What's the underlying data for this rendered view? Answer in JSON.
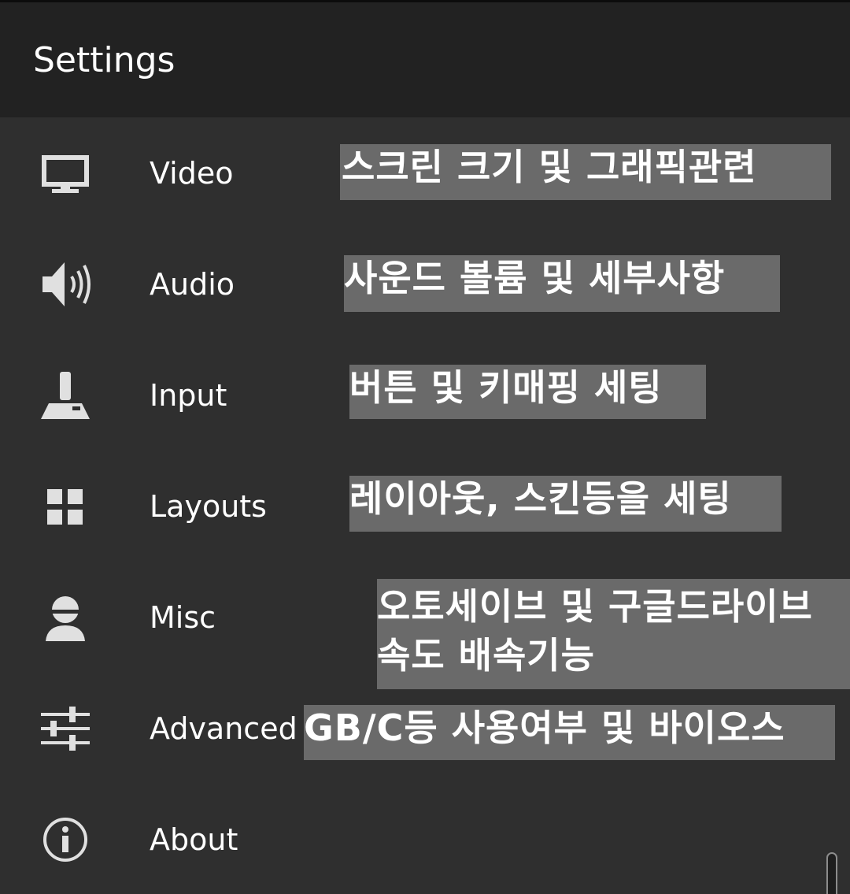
{
  "appbar": {
    "title": "Settings"
  },
  "menu": {
    "video": {
      "label": "Video",
      "icon": "monitor-icon"
    },
    "audio": {
      "label": "Audio",
      "icon": "speaker-icon"
    },
    "input": {
      "label": "Input",
      "icon": "joystick-icon"
    },
    "layouts": {
      "label": "Layouts",
      "icon": "grid-icon"
    },
    "misc": {
      "label": "Misc",
      "icon": "person-icon"
    },
    "advanced": {
      "label": "Advanced",
      "icon": "sliders-icon"
    },
    "about": {
      "label": "About",
      "icon": "info-icon"
    }
  },
  "notes": {
    "video": "스크린 크기 및 그래픽관련",
    "audio": "사운드 볼륨 및 세부사항",
    "input": "버튼 및 키매핑 세팅",
    "layouts": "레이아웃, 스킨등을 세팅",
    "misc_line1": "오토세이브 및 구글드라이브",
    "misc_line2": "속도 배속기능",
    "advanced": "GB/C등 사용여부 및 바이오스"
  },
  "colors": {
    "appbar_bg": "#222222",
    "list_bg": "#2f2f2f",
    "note_bg": "#6a6a6a",
    "text": "#ffffff",
    "icon": "#e0e0e0"
  }
}
